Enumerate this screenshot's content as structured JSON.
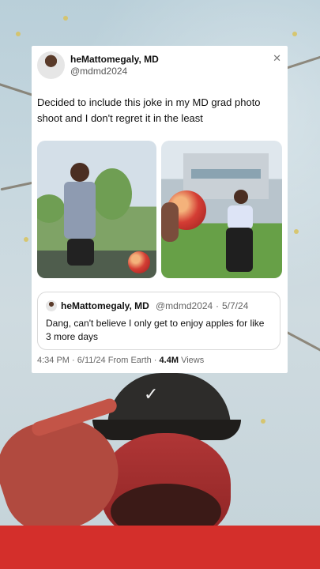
{
  "tweet": {
    "author_name": "heMattomegaly, MD",
    "author_handle": "@mdmd2024",
    "text": "Decided to include this joke in my MD grad photo shoot and I don't regret it in the least",
    "quote": {
      "author_name": "heMattomegaly, MD",
      "author_handle": "@mdmd2024",
      "separator": "·",
      "date": "5/7/24",
      "text": "Dang, can't believe I only get to enjoy apples for like 3 more days"
    },
    "meta": {
      "time": "4:34 PM",
      "date": "6/11/24",
      "source": "From Earth",
      "views_count": "4.4M",
      "views_label": "Views"
    }
  },
  "icons": {
    "close": "close-icon",
    "nike": "nike-swoosh-icon"
  }
}
